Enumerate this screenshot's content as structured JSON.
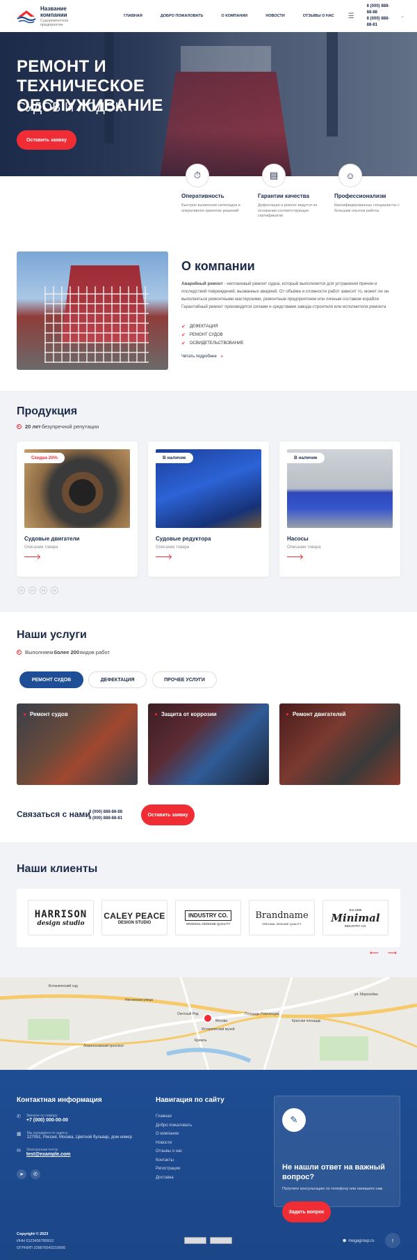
{
  "header": {
    "company_name": "Название компании",
    "company_sub": "Судоремонтное предприятие",
    "nav": [
      "ГЛАВНАЯ",
      "ДОБРО ПОЖАЛОВАТЬ",
      "О КОМПАНИИ",
      "НОВОСТИ",
      "ОТЗЫВЫ О НАС"
    ],
    "phone1": "8 (000) 888-88-88",
    "phone2": "8 (000) 888-88-81"
  },
  "hero": {
    "title": "РЕМОНТ И ТЕХНИЧЕСКОЕ ОБСЛУЖИВАНИЕ",
    "subtitle": "СУДОВ И ЛОДОК",
    "button": "Оставить заявку"
  },
  "features": [
    {
      "title": "Оперативность",
      "desc": "Быстрое выявление неполадок и оперативное принятие решений",
      "icon": "stopwatch-icon"
    },
    {
      "title": "Гарантии качества",
      "desc": "Дефектация и ремонт ведутся на основании соответствующих сертификатов",
      "icon": "document-icon"
    },
    {
      "title": "Профессионализм",
      "desc": "Квалифицированные специалисты с большим опытом работы",
      "icon": "worker-icon"
    }
  ],
  "about": {
    "title": "О компании",
    "lead": "Аварийный ремонт",
    "text": " - неплановый ремонт судна, который выполняется для устранения причин и последствий повреждений, вызванных аварией. От объёма и сложности работ зависит то, может ли он выполняться ремонтными мастерскими, ремонтным предприятием или личным составом корабля. Гарантийный ремонт производится силами и средствами завода-строителя или исполнителя ремонта",
    "checks": [
      "ДЕФЕКТАЦИЯ",
      "РЕМОНТ СУДОВ",
      "ОСВИДЕТЕЛЬСТВОВАНИЕ"
    ],
    "more": "Читать подробнее"
  },
  "products": {
    "title": "Продукция",
    "sub_bold": "20 лет",
    "sub_rest": " безупречной репутации",
    "items": [
      {
        "badge": "Скидка 20%",
        "title": "Судовые двигатели",
        "desc": "Описание товара"
      },
      {
        "badge": "В наличие",
        "title": "Судовые редуктора",
        "desc": "Описание товара"
      },
      {
        "badge": "В наличие",
        "title": "Насосы",
        "desc": "Описание товара"
      }
    ],
    "pages": [
      "01",
      "02",
      "03",
      "04"
    ]
  },
  "services": {
    "title": "Наши услуги",
    "sub_pre": "Выполняем ",
    "sub_bold": "более 200",
    "sub_post": " видов работ",
    "tabs": [
      "РЕМОНТ СУДОВ",
      "ДЕФЕКТАЦИЯ",
      "ПРОЧЕЕ УСЛУГИ"
    ],
    "cards": [
      "Ремонт судов",
      "Защита от коррозии",
      "Ремонт двигателей"
    ]
  },
  "contact_bar": {
    "title": "Связаться с нами",
    "phone1": "8 (000) 888-88-88",
    "phone2": "8 (000) 888-88-81",
    "button": "Оставить заявку"
  },
  "clients": {
    "title": "Наши клиенты",
    "logos": [
      {
        "main": "HARRISON",
        "sub": "design studio"
      },
      {
        "main": "CALEY PEACE",
        "sub": "DESIGN STUDIO"
      },
      {
        "main": "INDUSTRY CO.",
        "sub": "ORIGINAL GENUINE QUALITY"
      },
      {
        "main": "Brandname",
        "sub": "ORIGINAL GENUINE QUALITY"
      },
      {
        "main": "Minimal",
        "sub": "INDUSTRY CO.",
        "top": "Est.1986"
      }
    ]
  },
  "map": {
    "labels": [
      "Москва",
      "Охотный Ряд",
      "Ботанический сад",
      "Ломоносовский проспект",
      "ул. Маросейка",
      "Кремль",
      "Площадь Революции",
      "Исторический музей",
      "Неглинная улица",
      "Красная площадь"
    ]
  },
  "footer": {
    "contact_title": "Контактная информация",
    "phone_label": "Звоните по номеру:",
    "phone": "+7 (000) 000-00-00",
    "addr_label": "Мы находимся по адресу:",
    "addr": "127051, Россия, Москва, Цветной бульвар, дом номер",
    "email_label": "Электронная почта:",
    "email": "test@example.com",
    "nav_title": "Навигация по сайту",
    "nav": [
      "Главная",
      "Добро пожаловать",
      "О компании",
      "Новости",
      "Отзывы о нас",
      "Контакты",
      "Регистрация",
      "Доставка"
    ],
    "q_title": "Не нашли ответ на важный вопрос?",
    "q_desc": "Получите консультацию по телефону или напишите нам",
    "q_button": "Задать вопрос",
    "copyright": "Copyright © 2023",
    "inn": "ИНН 0123456789910",
    "ogrnip": "ОГРНИП 109876543210000",
    "dev": "megagroup.ru"
  },
  "colors": {
    "accent": "#f02c35",
    "brand": "#1e4e95",
    "dark": "#1b2a4a"
  }
}
